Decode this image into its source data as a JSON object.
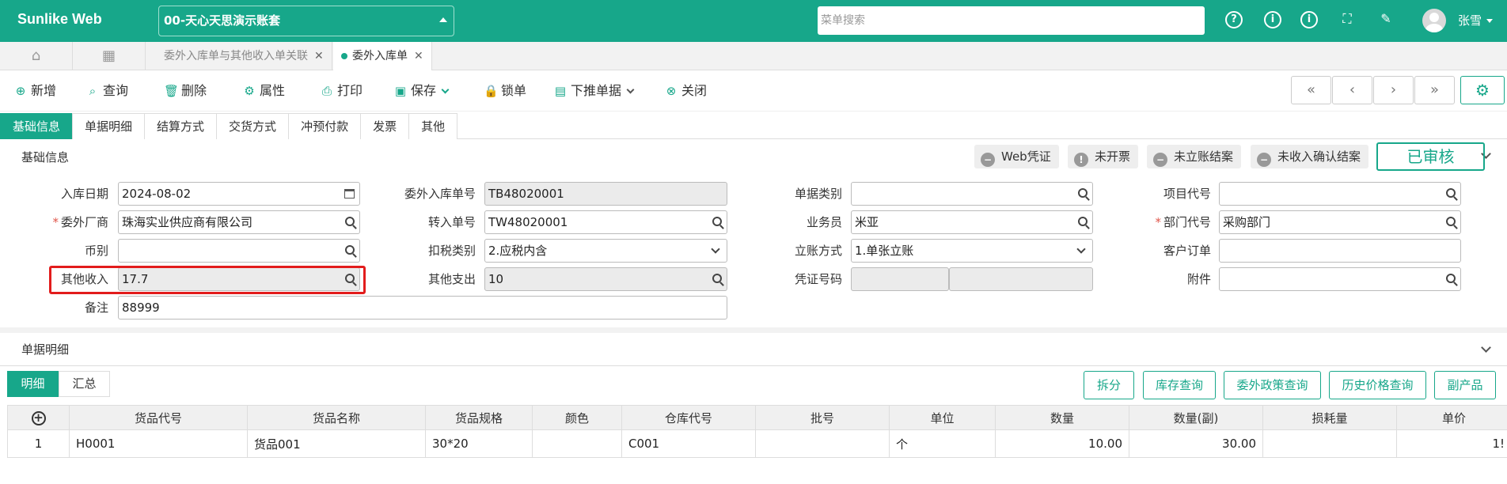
{
  "header": {
    "brand": "Sunlike Web",
    "account": "00-天心天思演示账套",
    "search_placeholder": "菜单搜索",
    "user": "张雪"
  },
  "tabs": [
    {
      "label": "委外入库单与其他收入单关联",
      "active": false
    },
    {
      "label": "委外入库单",
      "active": true
    }
  ],
  "toolbar": {
    "new": "新增",
    "query": "查询",
    "delete": "删除",
    "properties": "属性",
    "print": "打印",
    "save": "保存",
    "lock": "锁单",
    "push_down": "下推单据",
    "close": "关闭"
  },
  "section_tabs": [
    "基础信息",
    "单据明细",
    "结算方式",
    "交货方式",
    "冲预付款",
    "发票",
    "其他"
  ],
  "basic": {
    "title": "基础信息",
    "badges": {
      "voucher": "Web凭证",
      "invoice": "未开票",
      "settle": "未立账结案",
      "income": "未收入确认结案"
    },
    "status": "已审核",
    "fields": {
      "in_date": {
        "label": "入库日期",
        "value": "2024-08-02"
      },
      "vendor": {
        "label": "委外厂商",
        "value": "珠海实业供应商有限公司"
      },
      "currency": {
        "label": "币别",
        "value": ""
      },
      "other_income": {
        "label": "其他收入",
        "value": "17.7"
      },
      "remark": {
        "label": "备注",
        "value": "88999"
      },
      "order_no": {
        "label": "委外入库单号",
        "value": "TB48020001"
      },
      "transfer_no": {
        "label": "转入单号",
        "value": "TW48020001"
      },
      "tax_type": {
        "label": "扣税类别",
        "value": "2.应税内含"
      },
      "other_expense": {
        "label": "其他支出",
        "value": "10"
      },
      "doc_type": {
        "label": "单据类别",
        "value": ""
      },
      "salesman": {
        "label": "业务员",
        "value": "米亚"
      },
      "account_method": {
        "label": "立账方式",
        "value": "1.单张立账"
      },
      "voucher_no": {
        "label": "凭证号码",
        "value": ""
      },
      "project_code": {
        "label": "项目代号",
        "value": ""
      },
      "dept_code": {
        "label": "部门代号",
        "value": "采购部门"
      },
      "customer_order": {
        "label": "客户订单",
        "value": ""
      },
      "attachment": {
        "label": "附件",
        "value": ""
      }
    }
  },
  "detail": {
    "title": "单据明细",
    "subtabs": [
      "明细",
      "汇总"
    ],
    "actions": [
      "拆分",
      "库存查询",
      "委外政策查询",
      "历史价格查询",
      "副产品"
    ],
    "columns": [
      "货品代号",
      "货品名称",
      "货品规格",
      "颜色",
      "仓库代号",
      "批号",
      "单位",
      "数量",
      "数量(副)",
      "损耗量",
      "单价"
    ],
    "rows": [
      {
        "no": "1",
        "code": "H0001",
        "name": "货品001",
        "spec": "30*20",
        "color": "",
        "wh": "C001",
        "batch": "",
        "unit": "个",
        "qty": "10.00",
        "qty2": "30.00",
        "loss": "",
        "price": "1!"
      }
    ]
  }
}
